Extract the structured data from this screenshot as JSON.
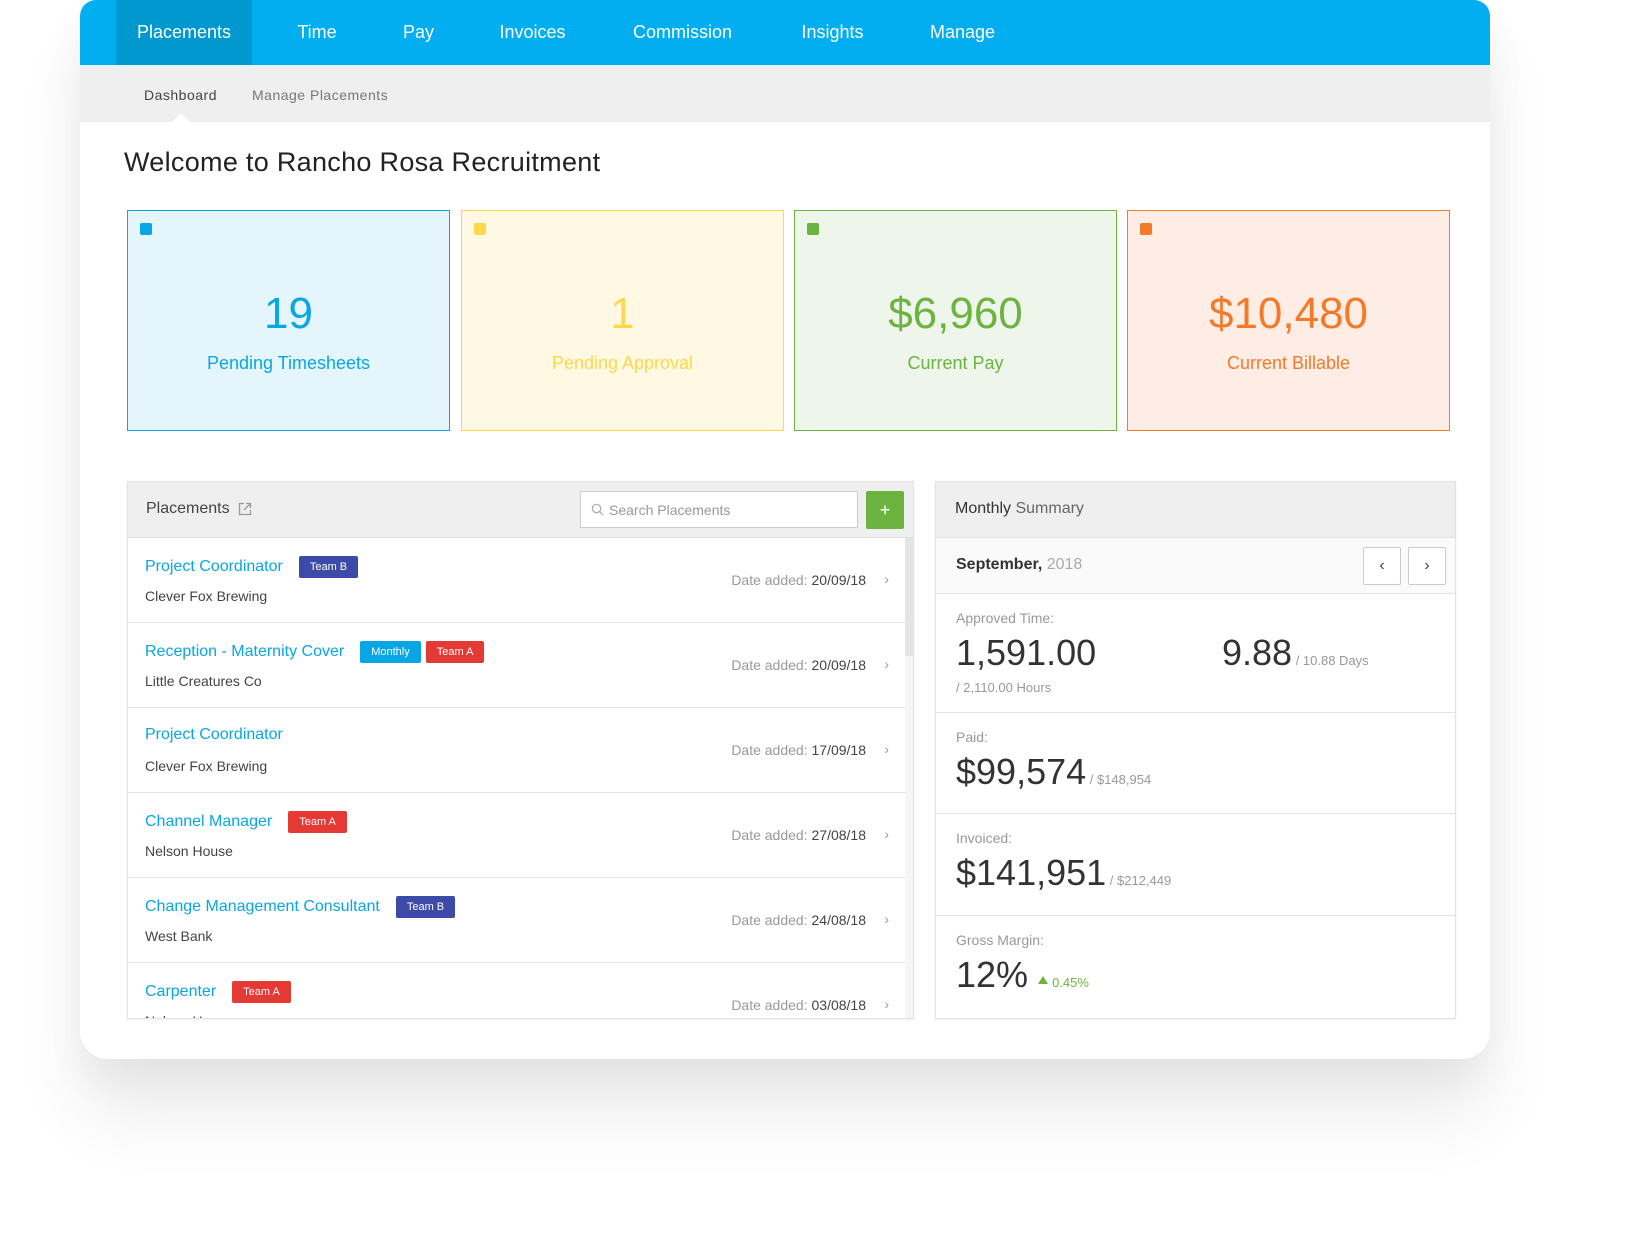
{
  "nav": {
    "items": [
      {
        "label": "Placements",
        "active": true
      },
      {
        "label": "Time",
        "active": false
      },
      {
        "label": "Pay",
        "active": false
      },
      {
        "label": "Invoices",
        "active": false
      },
      {
        "label": "Commission",
        "active": false
      },
      {
        "label": "Insights",
        "active": false
      },
      {
        "label": "Manage",
        "active": false
      }
    ]
  },
  "subnav": {
    "items": [
      {
        "label": "Dashboard",
        "active": true
      },
      {
        "label": "Manage Placements",
        "active": false
      }
    ]
  },
  "page": {
    "title": "Welcome to Rancho Rosa Recruitment"
  },
  "stats": [
    {
      "value": "19",
      "label": "Pending Timesheets",
      "color": "#08a6e4",
      "bg": "#e4f5fc"
    },
    {
      "value": "1",
      "label": "Pending Approval",
      "color": "#fdd84b",
      "bg": "#fff8e3"
    },
    {
      "value": "$6,960",
      "label": "Current Pay",
      "color": "#6cb33f",
      "bg": "#eef5ea"
    },
    {
      "value": "$10,480",
      "label": "Current Billable",
      "color": "#f47a2a",
      "bg": "#fdede4"
    }
  ],
  "placements": {
    "title": "Placements",
    "search_placeholder": "Search Placements",
    "add_label": "+",
    "date_prefix": "Date added:",
    "rows": [
      {
        "job": "Project Coordinator",
        "company": "Clever Fox Brewing",
        "date": "20/09/18",
        "tags": [
          {
            "label": "Team B",
            "color": "#3c4aa8"
          }
        ]
      },
      {
        "job": "Reception - Maternity Cover",
        "company": "Little Creatures Co",
        "date": "20/09/18",
        "tags": [
          {
            "label": "Monthly",
            "color": "#08a6e4"
          },
          {
            "label": "Team A",
            "color": "#e53935"
          }
        ]
      },
      {
        "job": "Project Coordinator",
        "company": "Clever Fox Brewing",
        "date": "17/09/18",
        "tags": []
      },
      {
        "job": "Channel Manager",
        "company": "Nelson House",
        "date": "27/08/18",
        "tags": [
          {
            "label": "Team A",
            "color": "#e53935"
          }
        ]
      },
      {
        "job": "Change Management Consultant",
        "company": "West Bank",
        "date": "24/08/18",
        "tags": [
          {
            "label": "Team B",
            "color": "#3c4aa8"
          }
        ]
      },
      {
        "job": "Carpenter",
        "company": "Nelson House",
        "date": "03/08/18",
        "tags": [
          {
            "label": "Team A",
            "color": "#e53935"
          }
        ]
      }
    ]
  },
  "summary": {
    "title_strong": "Monthly",
    "title_rest": " Summary",
    "month": "September,",
    "year": " 2018",
    "prev_label": "‹",
    "next_label": "›",
    "approved": {
      "label": "Approved Time:",
      "hours": "1,591.00",
      "hours_total": "/ 2,110.00 Hours",
      "days": "9.88",
      "days_total": " / 10.88 Days"
    },
    "paid": {
      "label": "Paid:",
      "amount": "$99,574",
      "total": " / $148,954"
    },
    "invoiced": {
      "label": "Invoiced:",
      "amount": "$141,951",
      "total": " / $212,449"
    },
    "margin": {
      "label": "Gross Margin:",
      "value": "12%",
      "delta": "0.45%",
      "delta_color": "#6cb33f"
    }
  }
}
